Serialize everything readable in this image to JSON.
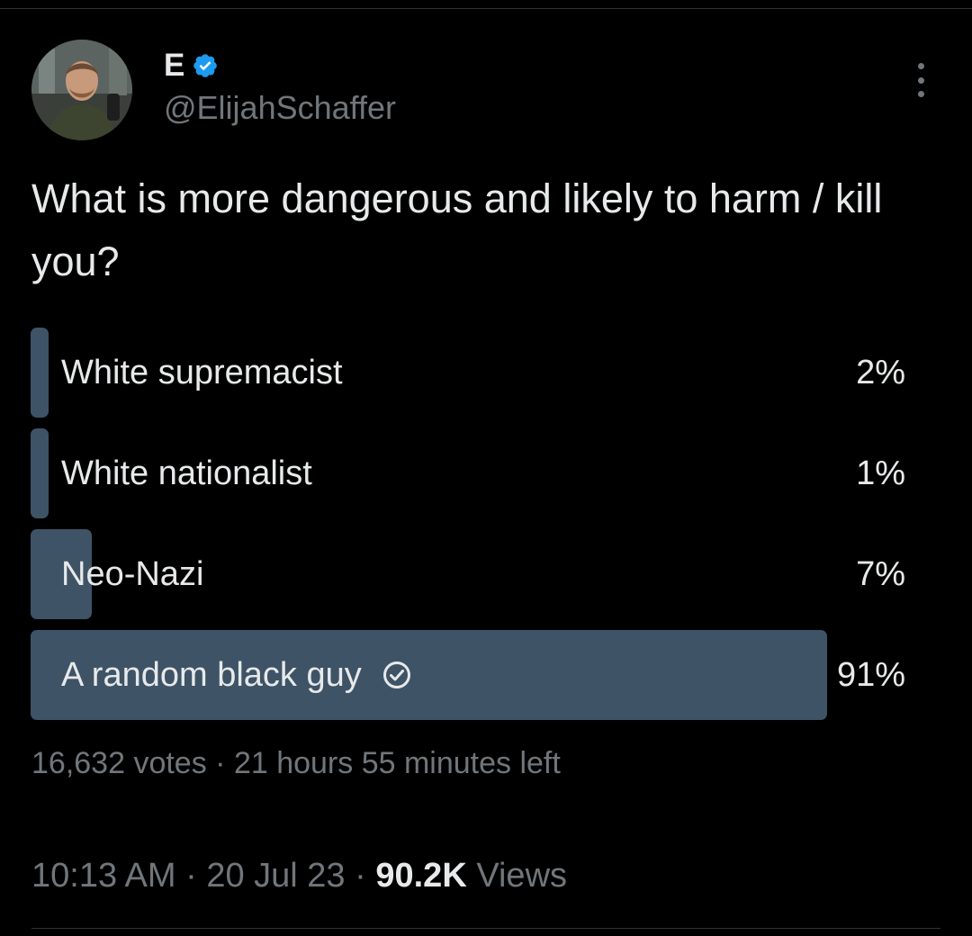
{
  "author": {
    "display_name": "E",
    "handle": "@ElijahSchaffer",
    "verified": true
  },
  "tweet": {
    "text": "What is more dangerous and likely to harm / kill you?"
  },
  "poll": {
    "options": [
      {
        "label": "White supremacist",
        "percent_label": "2%",
        "percent": 2,
        "selected": false
      },
      {
        "label": "White nationalist",
        "percent_label": "1%",
        "percent": 1,
        "selected": false
      },
      {
        "label": "Neo-Nazi",
        "percent_label": "7%",
        "percent": 7,
        "selected": false
      },
      {
        "label": "A random black guy",
        "percent_label": "91%",
        "percent": 91,
        "selected": true
      }
    ],
    "votes": "16,632 votes",
    "separator": "·",
    "time_left": "21 hours 55 minutes left"
  },
  "meta": {
    "time": "10:13 AM",
    "date": "20 Jul 23",
    "separator": "·",
    "views_count": "90.2K",
    "views_label": "Views"
  },
  "colors": {
    "background": "#000000",
    "text_primary": "#e7e9ea",
    "text_secondary": "#71767b",
    "poll_bar": "#3e5366",
    "verified_badge": "#1d9bf0"
  },
  "icons": {
    "verified": "verified-badge-icon",
    "more": "more-dots-icon",
    "selected": "check-circle-icon"
  }
}
